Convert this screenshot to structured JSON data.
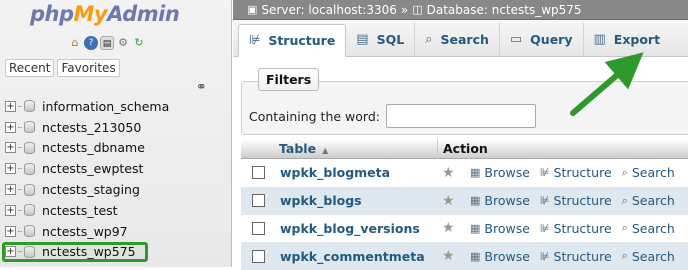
{
  "nav": {
    "logo": {
      "php": "php",
      "my": "My",
      "admin": "Admin"
    },
    "icons": [
      "home-icon",
      "help-icon",
      "docs-icon",
      "settings-icon",
      "reload-icon"
    ],
    "recent_tab": "Recent",
    "favorites_tab": "Favorites",
    "databases": [
      {
        "name": "information_schema",
        "selected": false
      },
      {
        "name": "nctests_213050",
        "selected": false
      },
      {
        "name": "nctests_dbname",
        "selected": false
      },
      {
        "name": "nctests_ewptest",
        "selected": false
      },
      {
        "name": "nctests_staging",
        "selected": false
      },
      {
        "name": "nctests_test",
        "selected": false
      },
      {
        "name": "nctests_wp97",
        "selected": false
      },
      {
        "name": "nctests_wp575",
        "selected": true
      }
    ]
  },
  "breadcrumb": {
    "server": "Server: localhost:3306",
    "separator": "»",
    "database": "Database: nctests_wp575"
  },
  "tabs": [
    {
      "label": "Structure",
      "icon": "structure-icon",
      "active": true
    },
    {
      "label": "SQL",
      "icon": "sql-icon",
      "active": false
    },
    {
      "label": "Search",
      "icon": "search-icon",
      "active": false
    },
    {
      "label": "Query",
      "icon": "query-icon",
      "active": false
    },
    {
      "label": "Export",
      "icon": "export-icon",
      "active": false
    }
  ],
  "filters": {
    "legend": "Filters",
    "label": "Containing the word:",
    "value": ""
  },
  "table": {
    "col_table": "Table",
    "col_action": "Action",
    "actions": {
      "browse": "Browse",
      "structure": "Structure",
      "search": "Search"
    },
    "rows": [
      {
        "name": "wpkk_blogmeta"
      },
      {
        "name": "wpkk_blogs"
      },
      {
        "name": "wpkk_blog_versions"
      },
      {
        "name": "wpkk_commentmeta"
      }
    ]
  },
  "colors": {
    "accent": "#235a81",
    "highlight": "#2f9a2c",
    "row_alt": "#dfe8ee",
    "breadcrumb_bg": "#888888"
  }
}
